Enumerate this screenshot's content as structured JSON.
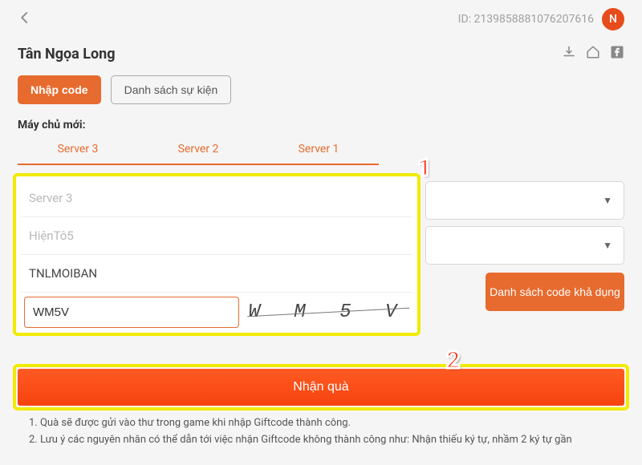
{
  "header": {
    "id_label": "ID: 2139858881076207616",
    "avatar_initial": "N"
  },
  "title": {
    "game_name": "Tân Ngọa Long"
  },
  "buttons": {
    "enter_code": "Nhập code",
    "event_list": "Danh sách sự kiện",
    "available_codes": "Danh sách code khả dụng",
    "receive_gift": "Nhận quà"
  },
  "labels": {
    "new_servers": "Máy chủ mới:"
  },
  "server_tabs": [
    "Server 3",
    "Server 2",
    "Server 1"
  ],
  "form": {
    "server_value": "Server 3",
    "character_value": "HiệnTô5",
    "code_value": "TNLMOIBAN",
    "captcha_value": "WM5V",
    "captcha_image_text": "W M 5 V"
  },
  "annotations": {
    "one": "1",
    "two": "2"
  },
  "notes": {
    "n1": "1. Quà sẽ được gửi vào thư trong game khi nhập Giftcode thành công.",
    "n2": "2. Lưu ý các nguyên nhân có thể dẫn tới việc nhận Giftcode không thành công như: Nhận thiếu ký tự, nhầm 2 ký tự gần"
  }
}
